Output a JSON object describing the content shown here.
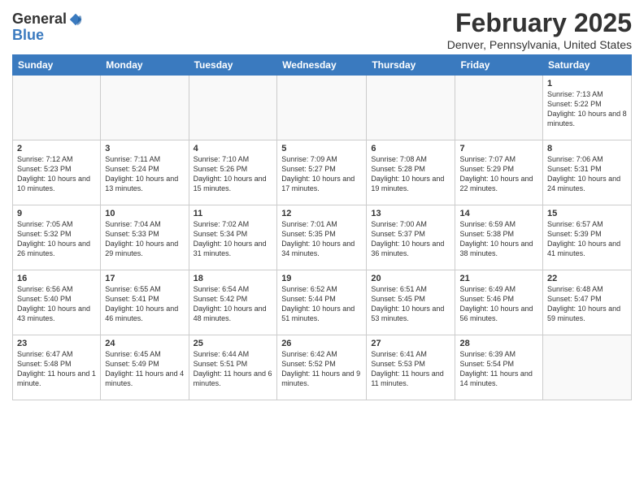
{
  "header": {
    "logo_general": "General",
    "logo_blue": "Blue",
    "month_title": "February 2025",
    "location": "Denver, Pennsylvania, United States"
  },
  "weekdays": [
    "Sunday",
    "Monday",
    "Tuesday",
    "Wednesday",
    "Thursday",
    "Friday",
    "Saturday"
  ],
  "weeks": [
    [
      {
        "day": "",
        "info": ""
      },
      {
        "day": "",
        "info": ""
      },
      {
        "day": "",
        "info": ""
      },
      {
        "day": "",
        "info": ""
      },
      {
        "day": "",
        "info": ""
      },
      {
        "day": "",
        "info": ""
      },
      {
        "day": "1",
        "info": "Sunrise: 7:13 AM\nSunset: 5:22 PM\nDaylight: 10 hours and 8 minutes."
      }
    ],
    [
      {
        "day": "2",
        "info": "Sunrise: 7:12 AM\nSunset: 5:23 PM\nDaylight: 10 hours and 10 minutes."
      },
      {
        "day": "3",
        "info": "Sunrise: 7:11 AM\nSunset: 5:24 PM\nDaylight: 10 hours and 13 minutes."
      },
      {
        "day": "4",
        "info": "Sunrise: 7:10 AM\nSunset: 5:26 PM\nDaylight: 10 hours and 15 minutes."
      },
      {
        "day": "5",
        "info": "Sunrise: 7:09 AM\nSunset: 5:27 PM\nDaylight: 10 hours and 17 minutes."
      },
      {
        "day": "6",
        "info": "Sunrise: 7:08 AM\nSunset: 5:28 PM\nDaylight: 10 hours and 19 minutes."
      },
      {
        "day": "7",
        "info": "Sunrise: 7:07 AM\nSunset: 5:29 PM\nDaylight: 10 hours and 22 minutes."
      },
      {
        "day": "8",
        "info": "Sunrise: 7:06 AM\nSunset: 5:31 PM\nDaylight: 10 hours and 24 minutes."
      }
    ],
    [
      {
        "day": "9",
        "info": "Sunrise: 7:05 AM\nSunset: 5:32 PM\nDaylight: 10 hours and 26 minutes."
      },
      {
        "day": "10",
        "info": "Sunrise: 7:04 AM\nSunset: 5:33 PM\nDaylight: 10 hours and 29 minutes."
      },
      {
        "day": "11",
        "info": "Sunrise: 7:02 AM\nSunset: 5:34 PM\nDaylight: 10 hours and 31 minutes."
      },
      {
        "day": "12",
        "info": "Sunrise: 7:01 AM\nSunset: 5:35 PM\nDaylight: 10 hours and 34 minutes."
      },
      {
        "day": "13",
        "info": "Sunrise: 7:00 AM\nSunset: 5:37 PM\nDaylight: 10 hours and 36 minutes."
      },
      {
        "day": "14",
        "info": "Sunrise: 6:59 AM\nSunset: 5:38 PM\nDaylight: 10 hours and 38 minutes."
      },
      {
        "day": "15",
        "info": "Sunrise: 6:57 AM\nSunset: 5:39 PM\nDaylight: 10 hours and 41 minutes."
      }
    ],
    [
      {
        "day": "16",
        "info": "Sunrise: 6:56 AM\nSunset: 5:40 PM\nDaylight: 10 hours and 43 minutes."
      },
      {
        "day": "17",
        "info": "Sunrise: 6:55 AM\nSunset: 5:41 PM\nDaylight: 10 hours and 46 minutes."
      },
      {
        "day": "18",
        "info": "Sunrise: 6:54 AM\nSunset: 5:42 PM\nDaylight: 10 hours and 48 minutes."
      },
      {
        "day": "19",
        "info": "Sunrise: 6:52 AM\nSunset: 5:44 PM\nDaylight: 10 hours and 51 minutes."
      },
      {
        "day": "20",
        "info": "Sunrise: 6:51 AM\nSunset: 5:45 PM\nDaylight: 10 hours and 53 minutes."
      },
      {
        "day": "21",
        "info": "Sunrise: 6:49 AM\nSunset: 5:46 PM\nDaylight: 10 hours and 56 minutes."
      },
      {
        "day": "22",
        "info": "Sunrise: 6:48 AM\nSunset: 5:47 PM\nDaylight: 10 hours and 59 minutes."
      }
    ],
    [
      {
        "day": "23",
        "info": "Sunrise: 6:47 AM\nSunset: 5:48 PM\nDaylight: 11 hours and 1 minute."
      },
      {
        "day": "24",
        "info": "Sunrise: 6:45 AM\nSunset: 5:49 PM\nDaylight: 11 hours and 4 minutes."
      },
      {
        "day": "25",
        "info": "Sunrise: 6:44 AM\nSunset: 5:51 PM\nDaylight: 11 hours and 6 minutes."
      },
      {
        "day": "26",
        "info": "Sunrise: 6:42 AM\nSunset: 5:52 PM\nDaylight: 11 hours and 9 minutes."
      },
      {
        "day": "27",
        "info": "Sunrise: 6:41 AM\nSunset: 5:53 PM\nDaylight: 11 hours and 11 minutes."
      },
      {
        "day": "28",
        "info": "Sunrise: 6:39 AM\nSunset: 5:54 PM\nDaylight: 11 hours and 14 minutes."
      },
      {
        "day": "",
        "info": ""
      }
    ]
  ]
}
